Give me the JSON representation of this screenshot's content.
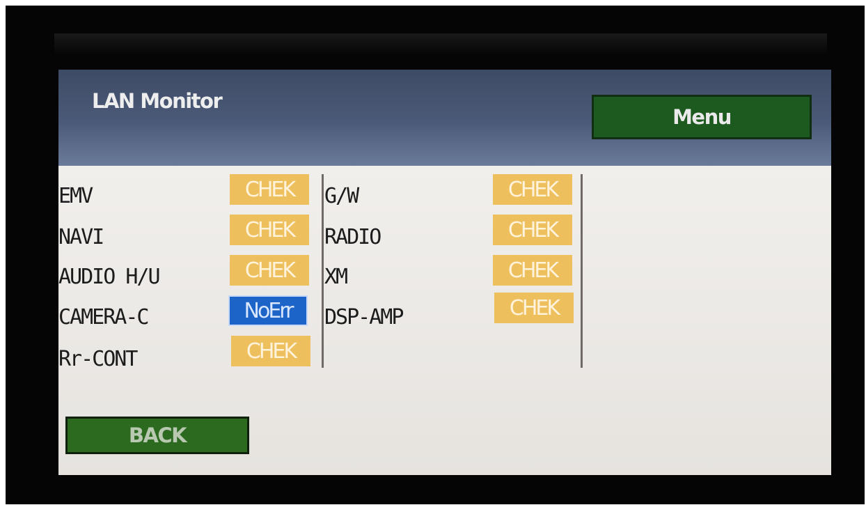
{
  "header": {
    "title": "LAN Monitor",
    "menu_label": "Menu"
  },
  "left_column": [
    {
      "name": "EMV",
      "status": "CHEK"
    },
    {
      "name": "NAVI",
      "status": "CHEK"
    },
    {
      "name": "AUDIO H/U",
      "status": "CHEK"
    },
    {
      "name": "CAMERA-C",
      "status": "NoErr"
    },
    {
      "name": "Rr-CONT",
      "status": "CHEK"
    }
  ],
  "right_column": [
    {
      "name": "G/W",
      "status": "CHEK"
    },
    {
      "name": "RADIO",
      "status": "CHEK"
    },
    {
      "name": "XM",
      "status": "CHEK"
    },
    {
      "name": "DSP-AMP",
      "status": "CHEK"
    }
  ],
  "footer": {
    "back_label": "BACK"
  },
  "colors": {
    "header_bg": "#4b5a78",
    "button_green": "#1d5a1f",
    "check_badge": "#eebf5d",
    "noerr_badge": "#1c64c8"
  }
}
